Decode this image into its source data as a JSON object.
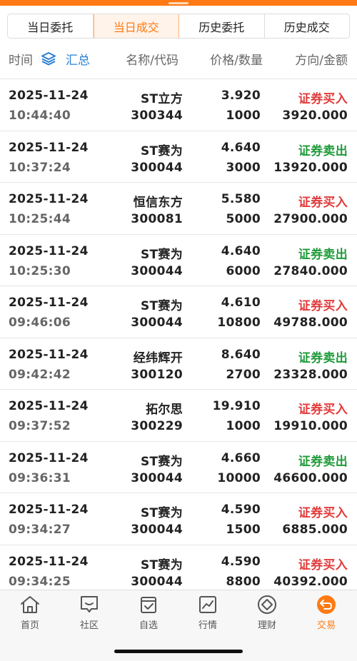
{
  "tabs": [
    {
      "label": "当日委托",
      "active": false
    },
    {
      "label": "当日成交",
      "active": true
    },
    {
      "label": "历史委托",
      "active": false
    },
    {
      "label": "历史成交",
      "active": false
    }
  ],
  "header": {
    "time": "时间",
    "summary": "汇总",
    "name_code": "名称/代码",
    "price_qty": "价格/数量",
    "dir_amount": "方向/金额"
  },
  "trades": [
    {
      "date": "2025-11-24",
      "time": "10:44:40",
      "name": "ST立方",
      "code": "300344",
      "price": "3.920",
      "qty": "1000",
      "direction": "证券买入",
      "side": "buy",
      "amount": "3920.000"
    },
    {
      "date": "2025-11-24",
      "time": "10:37:24",
      "name": "ST赛为",
      "code": "300044",
      "price": "4.640",
      "qty": "3000",
      "direction": "证券卖出",
      "side": "sell",
      "amount": "13920.000"
    },
    {
      "date": "2025-11-24",
      "time": "10:25:44",
      "name": "恒信东方",
      "code": "300081",
      "price": "5.580",
      "qty": "5000",
      "direction": "证券买入",
      "side": "buy",
      "amount": "27900.000"
    },
    {
      "date": "2025-11-24",
      "time": "10:25:30",
      "name": "ST赛为",
      "code": "300044",
      "price": "4.640",
      "qty": "6000",
      "direction": "证券卖出",
      "side": "sell",
      "amount": "27840.000"
    },
    {
      "date": "2025-11-24",
      "time": "09:46:06",
      "name": "ST赛为",
      "code": "300044",
      "price": "4.610",
      "qty": "10800",
      "direction": "证券买入",
      "side": "buy",
      "amount": "49788.000"
    },
    {
      "date": "2025-11-24",
      "time": "09:42:42",
      "name": "经纬辉开",
      "code": "300120",
      "price": "8.640",
      "qty": "2700",
      "direction": "证券卖出",
      "side": "sell",
      "amount": "23328.000"
    },
    {
      "date": "2025-11-24",
      "time": "09:37:52",
      "name": "拓尔思",
      "code": "300229",
      "price": "19.910",
      "qty": "1000",
      "direction": "证券买入",
      "side": "buy",
      "amount": "19910.000"
    },
    {
      "date": "2025-11-24",
      "time": "09:36:31",
      "name": "ST赛为",
      "code": "300044",
      "price": "4.660",
      "qty": "10000",
      "direction": "证券卖出",
      "side": "sell",
      "amount": "46600.000"
    },
    {
      "date": "2025-11-24",
      "time": "09:34:27",
      "name": "ST赛为",
      "code": "300044",
      "price": "4.590",
      "qty": "1500",
      "direction": "证券买入",
      "side": "buy",
      "amount": "6885.000"
    },
    {
      "date": "2025-11-24",
      "time": "09:34:25",
      "name": "ST赛为",
      "code": "300044",
      "price": "4.590",
      "qty": "8800",
      "direction": "证券买入",
      "side": "buy",
      "amount": "40392.000"
    }
  ],
  "bottom_nav": [
    {
      "label": "首页",
      "icon": "home-icon",
      "active": false
    },
    {
      "label": "社区",
      "icon": "chat-icon",
      "active": false
    },
    {
      "label": "自选",
      "icon": "watchlist-icon",
      "active": false
    },
    {
      "label": "行情",
      "icon": "chart-icon",
      "active": false
    },
    {
      "label": "理财",
      "icon": "diamond-icon",
      "active": false
    },
    {
      "label": "交易",
      "icon": "trade-icon",
      "active": true
    }
  ],
  "colors": {
    "accent": "#ff7a14",
    "buy": "#e23b3b",
    "sell": "#1f9b3a",
    "link": "#2a7fd4"
  }
}
